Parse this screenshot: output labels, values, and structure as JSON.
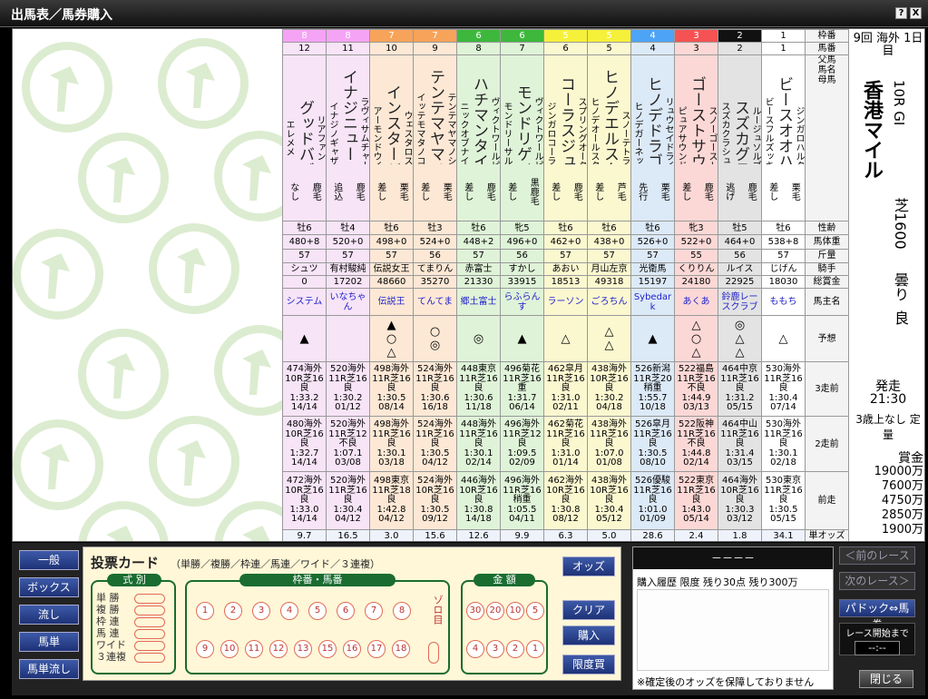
{
  "window": {
    "title": "出馬表／馬券購入",
    "help": "?",
    "close": "X"
  },
  "columns": [
    {
      "waku": "8",
      "num": "12",
      "wcol": "#f5a3f5",
      "bg": "#f7e4f7",
      "sire": "リアファン",
      "name": "グッドババ",
      "dam": "エレメメ",
      "style": "なし",
      "coat": "鹿毛",
      "sex": "牡6",
      "weight": "480+8",
      "kin": "57",
      "jockey": "シュツ",
      "money": "0",
      "owner": "システム",
      "marks": "▲",
      "r3": "474海外\n10R芝16\n良\n1:33.2\n14/14",
      "r2": "480海外\n10R芝16\n良\n1:32.7\n14/14",
      "r1": "472海外\n10R芝16\n良\n1:33.0\n14/14",
      "odds": "9.7"
    },
    {
      "waku": "8",
      "num": "11",
      "wcol": "#f5a3f5",
      "bg": "#f7e4f7",
      "sire": "ラヴィサムチャーム",
      "name": "イナジニューヨーク",
      "dam": "イナジノギャザー",
      "style": "追込",
      "coat": "鹿毛",
      "sex": "牡4",
      "weight": "520+0",
      "kin": "57",
      "jockey": "有村駿純",
      "money": "17202",
      "owner": "いなちゃん",
      "marks": "",
      "r3": "520海外\n11R芝16\n良\n1:30.2\n01/12",
      "r2": "520海外\n11R芝12\n不良\n1:07.1\n03/08",
      "r1": "520海外\n11R芝16\n良\n1:30.4\n04/12",
      "odds": "16.5"
    },
    {
      "waku": "7",
      "num": "10",
      "wcol": "#f7a35a",
      "bg": "#fde8d5",
      "sire": "ウェスタロス",
      "name": "インスタージュ",
      "dam": "アーモンドウイ",
      "style": "差し",
      "coat": "栗毛",
      "sex": "牡6",
      "weight": "498+0",
      "kin": "57",
      "jockey": "伝説女王",
      "money": "48660",
      "owner": "伝説王",
      "marks": "▲\n○\n△",
      "r3": "498海外\n11R芝16\n良\n1:30.5\n08/14",
      "r2": "498海外\n11R芝16\n良\n1:30.1\n03/18",
      "r1": "498東京\n11R芝18\n良\n1:42.8\n04/12",
      "odds": "3.0"
    },
    {
      "waku": "7",
      "num": "9",
      "wcol": "#f7a35a",
      "bg": "#fde8d5",
      "sire": "テンテマヤマノシタデ",
      "name": "テンテマヤマノコエ",
      "dam": "イッテモマタノコウタ",
      "style": "差し",
      "coat": "栗毛",
      "sex": "牡3",
      "weight": "524+0",
      "kin": "56",
      "jockey": "てまりん",
      "money": "35270",
      "owner": "てんてま",
      "marks": "○\n◎",
      "r3": "524海外\n11R芝16\n良\n1:30.6\n16/18",
      "r2": "524海外\n11R芝16\n良\n1:30.5\n04/12",
      "r1": "524海外\n10R芝16\n良\n1:30.5\n09/12",
      "odds": "15.6"
    },
    {
      "waku": "6",
      "num": "8",
      "wcol": "#3db83d",
      "bg": "#dff3d8",
      "sire": "ヴィクトワールピサ",
      "name": "ハチマンタイフジ",
      "dam": "ニックオブナイン",
      "style": "差し",
      "coat": "鹿毛",
      "sex": "牡6",
      "weight": "448+2",
      "kin": "57",
      "jockey": "赤富士",
      "money": "21330",
      "owner": "郷土富士",
      "marks": "◎",
      "r3": "448東京\n11R芝16\n良\n1:30.6\n11/18",
      "r2": "448海外\n11R芝16\n良\n1:30.1\n02/14",
      "r1": "446海外\n10R芝16\n良\n1:30.8\n14/18",
      "odds": "12.6"
    },
    {
      "waku": "6",
      "num": "7",
      "wcol": "#3db83d",
      "bg": "#dff3d8",
      "sire": "ヴィクトワールピサ",
      "name": "モンドリゲイン",
      "dam": "モンドリーサルト",
      "style": "差し",
      "coat": "黒鹿毛",
      "sex": "牝5",
      "weight": "496+0",
      "kin": "56",
      "jockey": "すかし",
      "money": "33915",
      "owner": "らふらんす",
      "marks": "▲",
      "r3": "496菊花\n11R芝16\n重\n1:31.7\n06/14",
      "r2": "496海外\n11R芝12\n良\n1:09.5\n02/09",
      "r1": "496海外\n11R芝16\n稍重\n1:05.5\n04/11",
      "odds": "9.9"
    },
    {
      "waku": "5",
      "num": "6",
      "wcol": "#f5f03a",
      "bg": "#fbf8d0",
      "sire": "スプリングオータム",
      "name": "コーラスジュウニ",
      "dam": "ジンガロコーラス",
      "style": "差し",
      "coat": "鹿毛",
      "sex": "牡6",
      "weight": "462+0",
      "kin": "57",
      "jockey": "あおい",
      "money": "18513",
      "owner": "ラーソン",
      "marks": "△",
      "r3": "462皐月\n11R芝16\n良\n1:31.0\n02/11",
      "r2": "462菊花\n11R芝16\n良\n1:31.0\n01/14",
      "r1": "462海外\n10R芝16\n良\n1:30.8\n08/12",
      "odds": "6.3"
    },
    {
      "waku": "5",
      "num": "5",
      "wcol": "#f5f03a",
      "bg": "#fbf8d0",
      "sire": "スノーテトラ",
      "name": "ヒノデエルスターズ",
      "dam": "ヒノデオールスター",
      "style": "差し",
      "coat": "芦毛",
      "sex": "牡6",
      "weight": "438+0",
      "kin": "57",
      "jockey": "月山左京",
      "money": "49318",
      "owner": "ごろちん",
      "marks": "△\n△",
      "r3": "438海外\n10R芝16\n良\n1:30.2\n04/18",
      "r2": "438海外\n11R芝16\n良\n1:07.0\n01/08",
      "r1": "438海外\n10R芝16\n良\n1:30.4\n05/12",
      "odds": "5.0"
    },
    {
      "waku": "4",
      "num": "4",
      "wcol": "#4da3f5",
      "bg": "#dce9f7",
      "sire": "リュウセイドライヴ",
      "name": "ヒノデドラゴニア",
      "dam": "ヒノデガーネット",
      "style": "先行",
      "coat": "栗毛",
      "sex": "牡6",
      "weight": "526+0",
      "kin": "57",
      "jockey": "光衛馬",
      "money": "15197",
      "owner": "Sybedark",
      "marks": "▲",
      "r3": "526新潟\n11R芝20\n稍重\n1:55.7\n10/18",
      "r2": "526皐月\n11R芝16\n良\n1:30.5\n08/10",
      "r1": "526優駿\n11R芝16\n良\n1:01.0\n01/09",
      "odds": "28.6"
    },
    {
      "waku": "3",
      "num": "3",
      "wcol": "#f55353",
      "bg": "#fbd8d6",
      "sire": "スノーゴースト",
      "name": "ゴーストサウンド",
      "dam": "ピュアサウンド",
      "style": "差し",
      "coat": "鹿毛",
      "sex": "牝3",
      "weight": "522+0",
      "kin": "55",
      "jockey": "くりりん",
      "money": "24180",
      "owner": "あくあ",
      "marks": "△\n○\n△",
      "r3": "522福島\n11R芝16\n不良\n1:44.9\n03/13",
      "r2": "522阪神\n11R芝16\n不良\n1:44.8\n02/14",
      "r1": "522東京\n11R芝16\n良\n1:43.0\n05/14",
      "odds": "2.4"
    },
    {
      "waku": "2",
      "num": "2",
      "wcol": "#111",
      "bg": "#e3e3e3",
      "sire": "ルージュソルブ",
      "name": "スズカグラ",
      "dam": "スズカクラシュー",
      "style": "逃げ",
      "coat": "鹿毛",
      "sex": "牡5",
      "weight": "464+0",
      "kin": "56",
      "jockey": "ルイス",
      "money": "22925",
      "owner": "鈴鹿レースクラブ",
      "marks": "◎\n△\n△",
      "r3": "464中京\n11R芝16\n良\n1:31.2\n05/15",
      "r2": "464中山\n11R芝16\n良\n1:31.4\n03/15",
      "r1": "464海外\n10R芝16\n良\n1:30.3\n03/12",
      "odds": "1.8"
    },
    {
      "waku": "1",
      "num": "1",
      "wcol": "#fff",
      "bg": "#fff",
      "sire": "ジンガロハルク",
      "name": "ビースオオハナビ",
      "dam": "ビースフルズッキン",
      "style": "差し",
      "coat": "栗毛",
      "sex": "牡6",
      "weight": "538+8",
      "kin": "57",
      "jockey": "じげん",
      "money": "18030",
      "owner": "ももち",
      "marks": "△",
      "r3": "530海外\n11R芝16\n良\n1:30.4\n07/14",
      "r2": "530海外\n11R芝16\n良\n1:30.1\n02/18",
      "r1": "530東京\n11R芝16\n良\n1:30.5\n05/15",
      "odds": "34.1"
    }
  ],
  "row_headers": {
    "waku": "枠番",
    "num": "馬番",
    "names": "父馬\n馬名\n母馬",
    "style_coat": "脚質 毛色",
    "sex": "性齢",
    "weight": "馬体重",
    "kin": "斤量",
    "jockey": "騎手",
    "money": "総賞金",
    "owner": "馬主名",
    "marks": "予想",
    "r3": "3走前",
    "r2": "2走前",
    "r1": "前走",
    "odds": "単オッズ"
  },
  "race": {
    "day": "9回 海外 1日目",
    "race_no": "10R GI",
    "name": "香港マイル",
    "course": "芝1600",
    "weather": "曇り",
    "going": "良",
    "start_label": "発走",
    "start_time": "21:30",
    "cond": "3歳上なし 定量",
    "prize_label": "賞金",
    "prizes": [
      "19000万",
      "7600万",
      "4750万",
      "2850万",
      "1900万"
    ]
  },
  "bet": {
    "left_buttons": [
      "一般",
      "ボックス",
      "流し",
      "馬単",
      "馬単流し"
    ],
    "card_title": "投票カード",
    "card_sub": "（単勝／複勝／枠連／馬連／ワイド／３連複）",
    "types_label": "式 別",
    "types": [
      "単 勝",
      "複 勝",
      "枠 連",
      "馬 連",
      "ワイド",
      "３連複"
    ],
    "nums_label": "枠番・馬番",
    "row1": [
      "1",
      "2",
      "3",
      "4",
      "5",
      "6",
      "7",
      "8"
    ],
    "row2": [
      "9",
      "10",
      "11",
      "12",
      "13",
      "15",
      "16",
      "17",
      "18"
    ],
    "zoro": "ゾロ目",
    "amount_label": "金 額",
    "amt1": [
      "30",
      "20",
      "10",
      "5"
    ],
    "amt2": [
      "4",
      "3",
      "2",
      "1"
    ],
    "right_buttons": [
      "オッズ",
      "クリア",
      "購入",
      "限度買"
    ]
  },
  "history": {
    "odds_bar": "－－－－",
    "header": "購入履歴 限度 残り30点 残り300万",
    "note": "※確定後のオッズを保障しておりません"
  },
  "nav": {
    "prev": "＜前のレース",
    "next": "次のレース＞",
    "paddock": "パドック⇔馬券",
    "countdown_label": "レース開始まで",
    "countdown": "--:--",
    "close": "閉じる"
  }
}
